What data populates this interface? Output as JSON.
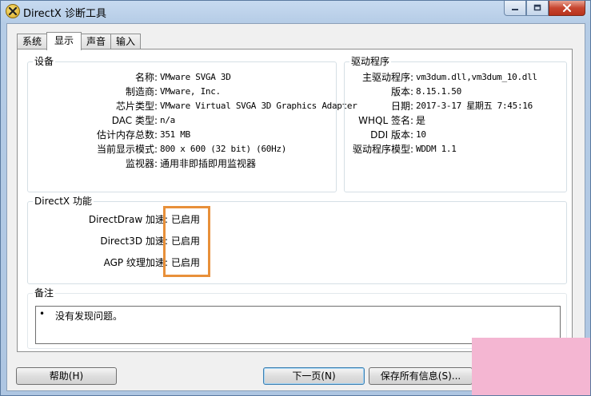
{
  "window": {
    "title": "DirectX 诊断工具"
  },
  "tabs": [
    {
      "label": "系统"
    },
    {
      "label": "显示"
    },
    {
      "label": "声音"
    },
    {
      "label": "输入"
    }
  ],
  "device": {
    "title": "设备",
    "rows": [
      {
        "label": "名称:",
        "value": "VMware SVGA 3D"
      },
      {
        "label": "制造商:",
        "value": "VMware, Inc."
      },
      {
        "label": "芯片类型:",
        "value": "VMware Virtual SVGA 3D Graphics Adapter"
      },
      {
        "label": "DAC 类型:",
        "value": "n/a"
      },
      {
        "label": "估计内存总数:",
        "value": "351 MB"
      },
      {
        "label": "当前显示模式:",
        "value": "800 x 600 (32 bit) (60Hz)"
      },
      {
        "label": "监视器:",
        "value": "通用非即插即用监视器"
      }
    ]
  },
  "driver": {
    "title": "驱动程序",
    "rows": [
      {
        "label": "主驱动程序:",
        "value": "vm3dum.dll,vm3dum_10.dll"
      },
      {
        "label": "版本:",
        "value": "8.15.1.50"
      },
      {
        "label": "日期:",
        "value": "2017-3-17 星期五 7:45:16"
      },
      {
        "label": "WHQL 签名:",
        "value": "是"
      },
      {
        "label": "DDI 版本:",
        "value": "10"
      },
      {
        "label": "驱动程序模型:",
        "value": "WDDM 1.1"
      }
    ]
  },
  "directx": {
    "title": "DirectX 功能",
    "rows": [
      {
        "label": "DirectDraw 加速:",
        "value": "已启用"
      },
      {
        "label": "Direct3D 加速:",
        "value": "已启用"
      },
      {
        "label": "AGP 纹理加速:",
        "value": "已启用"
      }
    ],
    "highlight_color": "#e8903a"
  },
  "notes": {
    "title": "备注",
    "bullet": "•",
    "text": "没有发现问题。"
  },
  "buttons": {
    "help": "帮助(H)",
    "next": "下一页(N)",
    "save": "保存所有信息(S)..."
  }
}
